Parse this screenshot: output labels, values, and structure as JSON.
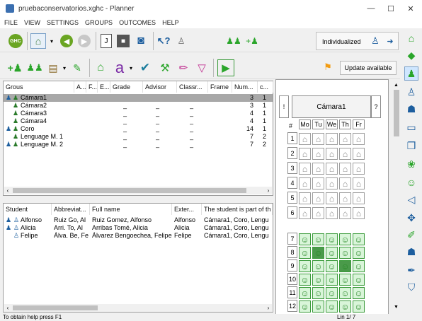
{
  "window": {
    "title": "pruebaconservatorios.xghc - Planner",
    "minimize": "—",
    "maximize": "☐",
    "close": "✕"
  },
  "menu": [
    "FILE",
    "VIEW",
    "SETTINGS",
    "GROUPS",
    "OUTCOMES",
    "HELP"
  ],
  "toolbar": {
    "individualized_label": "Individualized",
    "update_label": "Update available",
    "ghc_logo": "GHC",
    "icons_row1": [
      "ghc-logo-icon",
      "home-icon",
      "back-arrow-icon",
      "forward-arrow-icon",
      "document-icon",
      "save-icon",
      "car-icon",
      "help-cursor-icon",
      "teachers-icon",
      "group-settings-icon",
      "add-group-icon",
      "individualized-icon",
      "arrow-dropdown-icon"
    ],
    "icons_row2": [
      "add-student-icon",
      "add-group-icon",
      "paste-icon",
      "edit-icon",
      "building-icon",
      "font-icon",
      "check-icon",
      "tools-icon",
      "pencil-icon",
      "filter-icon",
      "run-icon",
      "flag-icon"
    ]
  },
  "colors": {
    "accent_green": "#2aa52a",
    "selection": "#a8a8a8",
    "smiley": "#b4f0b4",
    "flag": "#f39c12"
  },
  "groups_table": {
    "headers": [
      "Grous",
      "A...",
      "F...",
      "E...",
      "Grade",
      "Advisor",
      "Classr...",
      "Frame",
      "Num...",
      "c..."
    ],
    "rows": [
      {
        "name": "Cámara1",
        "grade": "",
        "advisor": "",
        "classroom": "",
        "num": "3",
        "c": "1",
        "selected": true,
        "tagged": true
      },
      {
        "name": "Cámara2",
        "grade": "_",
        "advisor": "_",
        "classroom": "_",
        "num": "3",
        "c": "1",
        "selected": false,
        "tagged": false
      },
      {
        "name": "Cámara3",
        "grade": "_",
        "advisor": "_",
        "classroom": "_",
        "num": "4",
        "c": "1",
        "selected": false,
        "tagged": false
      },
      {
        "name": "Cámara4",
        "grade": "_",
        "advisor": "_",
        "classroom": "_",
        "num": "4",
        "c": "1",
        "selected": false,
        "tagged": false
      },
      {
        "name": "Coro",
        "grade": "_",
        "advisor": "_",
        "classroom": "_",
        "num": "14",
        "c": "1",
        "selected": false,
        "tagged": true
      },
      {
        "name": "Lenguage M. 1",
        "grade": "_",
        "advisor": "_",
        "classroom": "_",
        "num": "7",
        "c": "2",
        "selected": false,
        "tagged": false
      },
      {
        "name": "Lenguage M. 2",
        "grade": "_",
        "advisor": "_",
        "classroom": "_",
        "num": "7",
        "c": "2",
        "selected": false,
        "tagged": true
      }
    ]
  },
  "students_table": {
    "headers": [
      "Student",
      "Abbreviat...",
      "Full name",
      "Exter...",
      "The student is part of th"
    ],
    "rows": [
      {
        "name": "Alfonso",
        "abbr": "Ruiz Go, Al",
        "full": "Ruiz Gomez, Alfonso",
        "ext": "Alfonso",
        "groups": "Cámara1, Coro, Lengu",
        "tagged": true
      },
      {
        "name": "Alicia",
        "abbr": "Arri. To, Al",
        "full": "Arribas Tomé, Alicia",
        "ext": "Alicia",
        "groups": "Cámara1, Coro, Lengu",
        "tagged": true
      },
      {
        "name": "Felipe",
        "abbr": "Álva. Be, Fe",
        "full": "Álvarez Bengoechea, Felipe",
        "ext": "Felipe",
        "groups": "Cámara1, Coro, Lengu",
        "tagged": false
      }
    ]
  },
  "timetable": {
    "excl": "!",
    "title": "Cámara1",
    "help": "?",
    "corner": "#",
    "days": [
      "Mo",
      "Tu",
      "We",
      "Th",
      "Fr"
    ],
    "periods": [
      "1",
      "2",
      "3",
      "4",
      "5",
      "6",
      "7",
      "8",
      "9",
      "10",
      "11",
      "12"
    ],
    "dark_cells": [
      [
        8,
        1
      ],
      [
        9,
        3
      ]
    ]
  },
  "status": {
    "left": "To obtain help press F1",
    "right": "Lin 1/ 7"
  }
}
